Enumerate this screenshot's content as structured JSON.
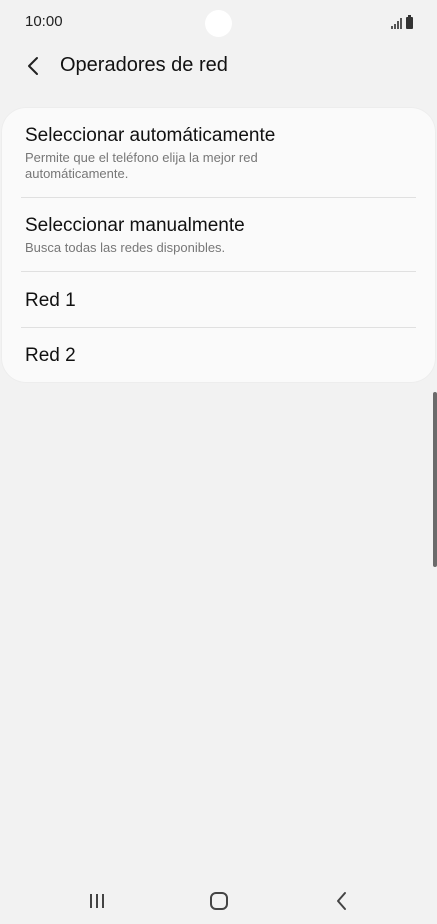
{
  "status_bar": {
    "time": "10:00"
  },
  "header": {
    "title": "Operadores de red",
    "back_icon": "chevron-left-icon"
  },
  "list": {
    "items": [
      {
        "title": "Seleccionar automáticamente",
        "subtitle": "Permite que el teléfono elija la mejor red automáticamente."
      },
      {
        "title": "Seleccionar manualmente",
        "subtitle": "Busca todas las redes disponibles."
      },
      {
        "title": "Red 1"
      },
      {
        "title": "Red 2"
      }
    ]
  },
  "nav_bar": {
    "icons": [
      "recent-apps-icon",
      "home-icon",
      "back-icon"
    ]
  },
  "colors": {
    "background": "#f2f2f2",
    "card": "#fafafa",
    "subtext": "#777777",
    "divider": "#e0e0e0"
  }
}
